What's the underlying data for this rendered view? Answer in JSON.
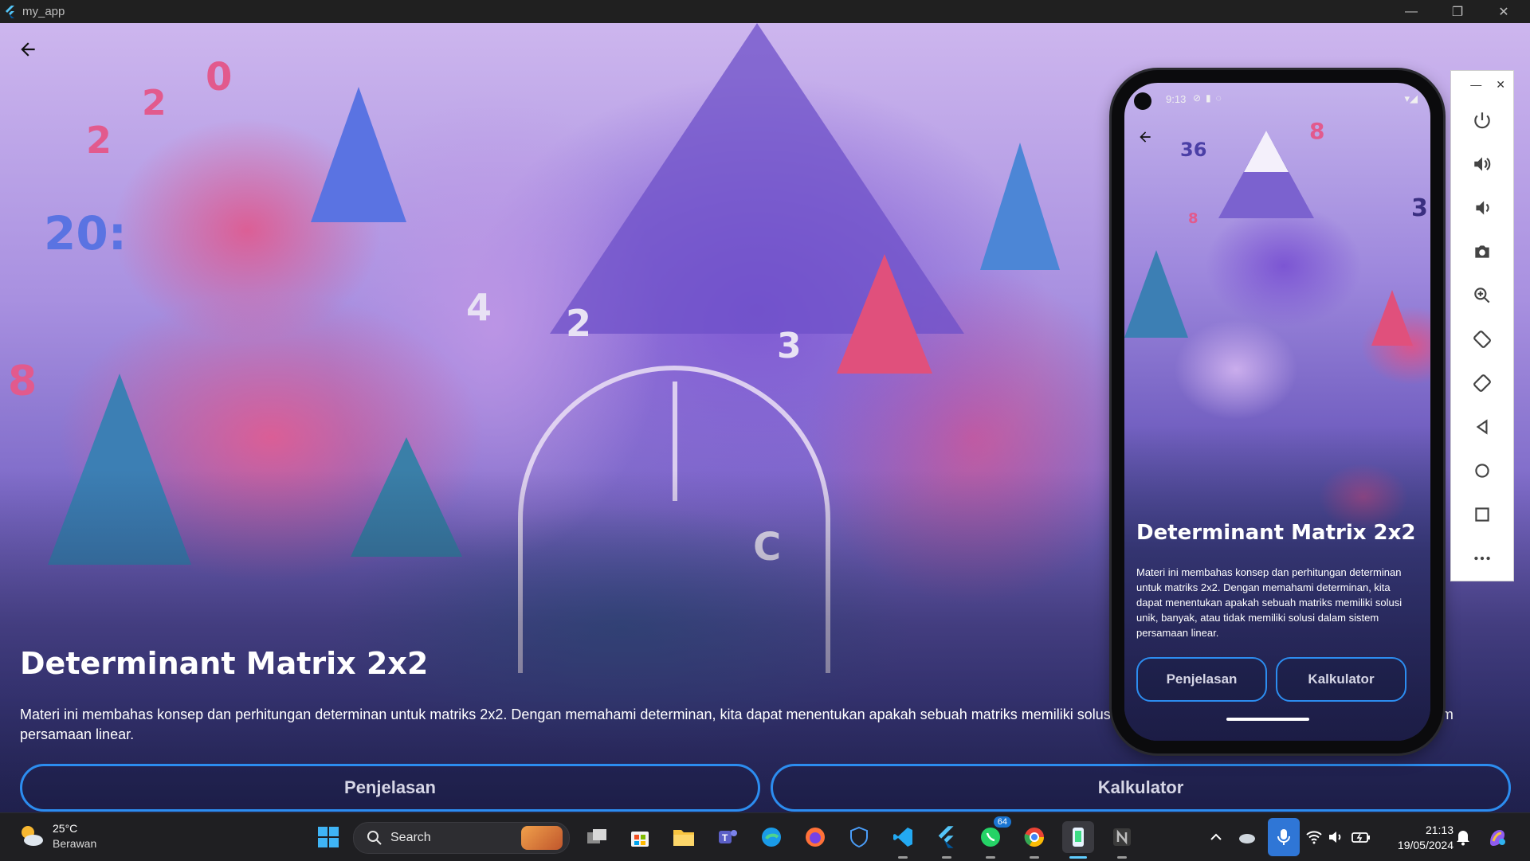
{
  "window": {
    "title": "my_app",
    "minimize": "—",
    "maximize": "❐",
    "close": "✕"
  },
  "main": {
    "back_icon": "arrow-left-icon",
    "title": "Determinant Matrix 2x2",
    "description": "Materi ini membahas konsep dan perhitungan determinan untuk matriks 2x2. Dengan memahami determinan, kita dapat menentukan apakah sebuah matriks memiliki solusi unik, banyak, atau tidak memiliki solusi dalam sistem persamaan linear.",
    "buttons": [
      {
        "label": "Penjelasan"
      },
      {
        "label": "Kalkulator"
      }
    ],
    "accent_color": "#2c8df0",
    "decor_numbers": [
      "0",
      "2",
      "2",
      "8",
      "20:",
      "4",
      "2",
      "3",
      "C",
      "36",
      "8",
      "8",
      "3"
    ]
  },
  "phone": {
    "status_time": "9:13",
    "title": "Determinant Matrix 2x2",
    "description": "Materi ini membahas konsep dan perhitungan determinan untuk matriks 2x2. Dengan memahami determinan, kita dapat menentukan apakah sebuah matriks memiliki solusi unik, banyak, atau tidak memiliki solusi dalam sistem persamaan linear.",
    "buttons": [
      {
        "label": "Penjelasan"
      },
      {
        "label": "Kalkulator"
      }
    ]
  },
  "emulator_toolbar": {
    "controls": [
      "power-icon",
      "volume-up-icon",
      "volume-down-icon",
      "camera-icon",
      "zoom-icon",
      "rotate-left-icon",
      "rotate-right-icon",
      "back-icon",
      "home-icon",
      "overview-icon",
      "more-icon"
    ],
    "minimize": "—",
    "close": "✕"
  },
  "taskbar": {
    "weather_temp": "25°C",
    "weather_desc": "Berawan",
    "search_placeholder": "Search",
    "whatsapp_badge": "64",
    "time": "21:13",
    "date": "19/05/2024"
  }
}
